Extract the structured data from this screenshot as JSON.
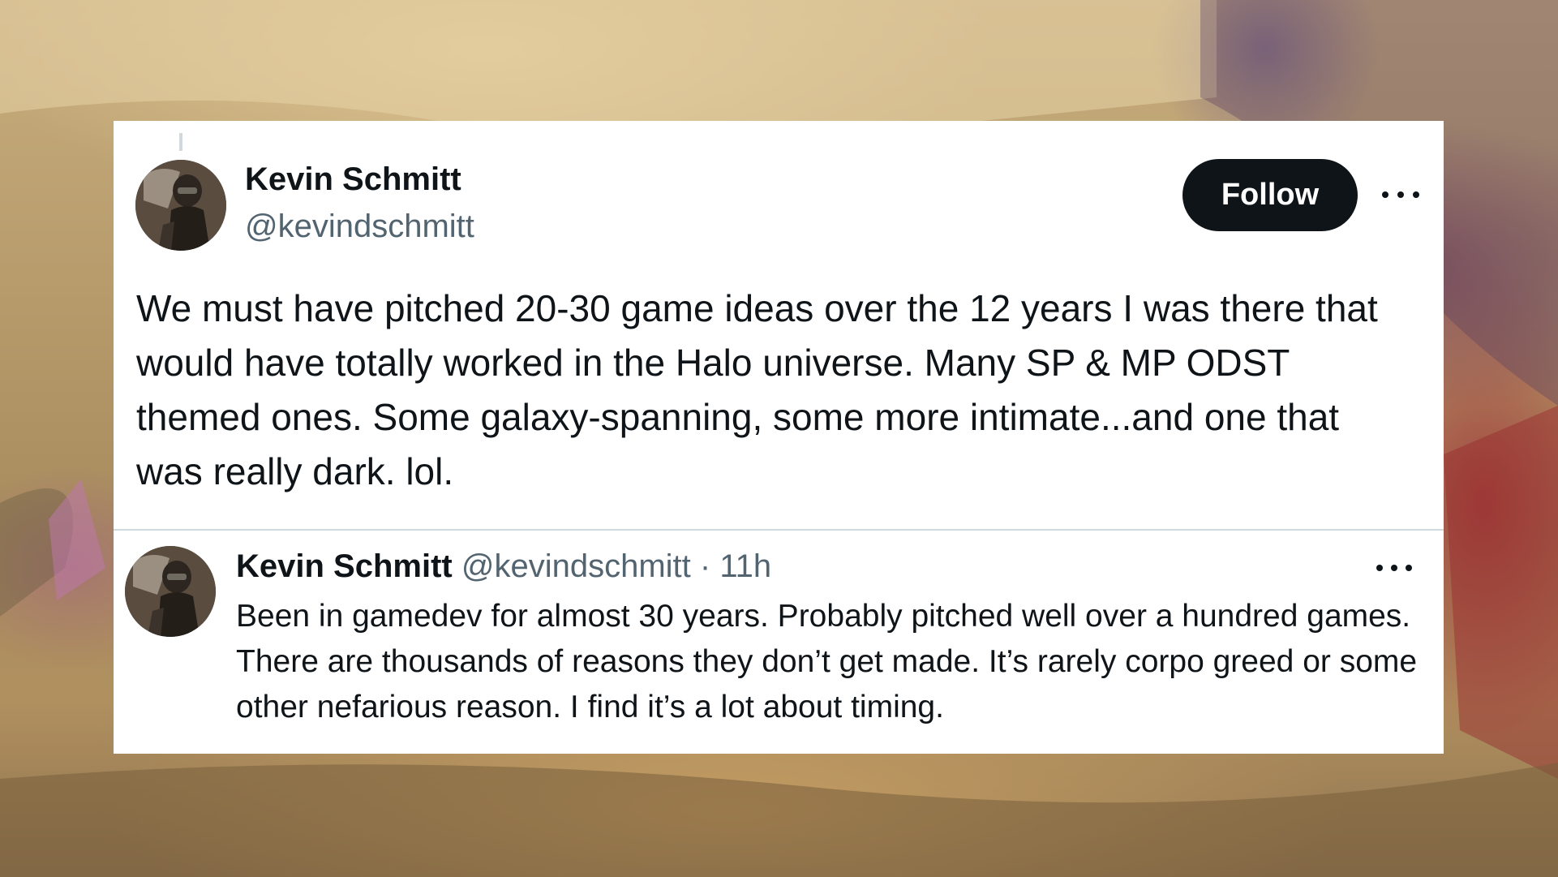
{
  "main_tweet": {
    "display_name": "Kevin Schmitt",
    "handle": "@kevindschmitt",
    "follow_label": "Follow",
    "text": "We must have pitched 20-30 game ideas over the 12 years I was there that would have totally worked in the Halo universe. Many SP & MP ODST themed ones. Some galaxy-spanning, some more intimate...and one that was really dark. lol."
  },
  "reply_tweet": {
    "display_name": "Kevin Schmitt",
    "handle": "@kevindschmitt",
    "separator": "·",
    "time": "11h",
    "text": "Been in gamedev for almost 30 years. Probably pitched well over a hundred games. There are thousands of reasons they don’t get made. It’s rarely corpo greed or some other nefarious reason. I find it’s a lot about timing."
  },
  "icons": {
    "more": "more-horizontal-icon",
    "avatar": "profile-avatar"
  },
  "colors": {
    "text_primary": "#0f1419",
    "text_secondary": "#536471",
    "follow_button_bg": "#0f1419",
    "card_bg": "#ffffff",
    "divider": "#cfd9de"
  }
}
